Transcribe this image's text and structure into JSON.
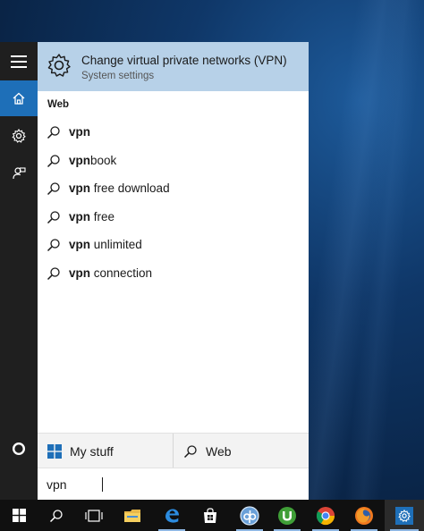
{
  "search": {
    "query": "vpn"
  },
  "best_match": {
    "title": "Change virtual private networks (VPN)",
    "subtitle": "System settings",
    "icon": "gear-icon"
  },
  "web_section": {
    "label": "Web",
    "suggestions": [
      {
        "bold": "vpn",
        "rest": ""
      },
      {
        "bold": "vpn",
        "rest": "book"
      },
      {
        "bold": "vpn",
        "rest": " free download"
      },
      {
        "bold": "vpn",
        "rest": " free"
      },
      {
        "bold": "vpn",
        "rest": " unlimited"
      },
      {
        "bold": "vpn",
        "rest": " connection"
      }
    ]
  },
  "filters": {
    "my_stuff": "My stuff",
    "web": "Web"
  },
  "rail": {
    "items": [
      "hamburger-menu-icon",
      "home-icon",
      "settings-icon",
      "feedback-icon",
      "cortana-circle-icon"
    ]
  },
  "taskbar": {
    "items": [
      "start-icon",
      "search-icon",
      "task-view-icon",
      "file-explorer-icon",
      "edge-icon",
      "store-icon",
      "qbittorrent-icon",
      "utorrent-icon",
      "chrome-icon",
      "firefox-icon",
      "settings-icon"
    ]
  },
  "colors": {
    "accent": "#1e6fb8",
    "best_match_bg": "#b7d1e8",
    "rail_bg": "#1f1f1f",
    "taskbar_bg": "#101010"
  }
}
